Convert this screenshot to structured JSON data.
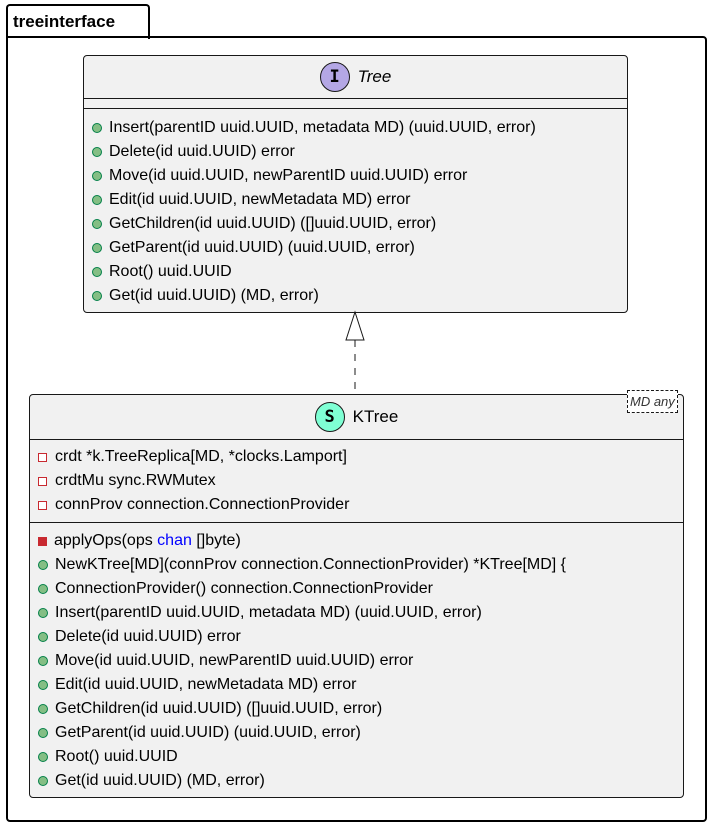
{
  "package": {
    "name": "treeinterface"
  },
  "interface": {
    "stereotype_letter": "I",
    "name": "Tree",
    "methods": [
      "Insert(parentID uuid.UUID, metadata MD) (uuid.UUID, error)",
      "Delete(id uuid.UUID) error",
      "Move(id uuid.UUID, newParentID uuid.UUID) error",
      "Edit(id uuid.UUID, newMetadata MD) error",
      "GetChildren(id uuid.UUID) ([]uuid.UUID, error)",
      "GetParent(id uuid.UUID) (uuid.UUID, error)",
      "Root() uuid.UUID",
      "Get(id uuid.UUID) (MD, error)"
    ]
  },
  "struct": {
    "stereotype_letter": "S",
    "name": "KTree",
    "generic": "MD any",
    "fields": [
      "crdt *k.TreeReplica[MD, *clocks.Lamport]",
      "crdtMu sync.RWMutex",
      "connProv connection.ConnectionProvider"
    ],
    "private_method": {
      "pre": "applyOps(ops ",
      "kw": "chan",
      "post": " []byte)"
    },
    "methods": [
      "NewKTree[MD](connProv connection.ConnectionProvider) *KTree[MD] {",
      "ConnectionProvider() connection.ConnectionProvider",
      "Insert(parentID uuid.UUID, metadata MD) (uuid.UUID, error)",
      "Delete(id uuid.UUID) error",
      "Move(id uuid.UUID, newParentID uuid.UUID) error",
      "Edit(id uuid.UUID, newMetadata MD) error",
      "GetChildren(id uuid.UUID) ([]uuid.UUID, error)",
      "GetParent(id uuid.UUID) (uuid.UUID, error)",
      "Root() uuid.UUID",
      "Get(id uuid.UUID) (MD, error)"
    ]
  },
  "colors": {
    "interface_badge": "#b4a7e5",
    "struct_badge": "#7fffd4",
    "public": "#84be84",
    "private": "#c82930"
  }
}
